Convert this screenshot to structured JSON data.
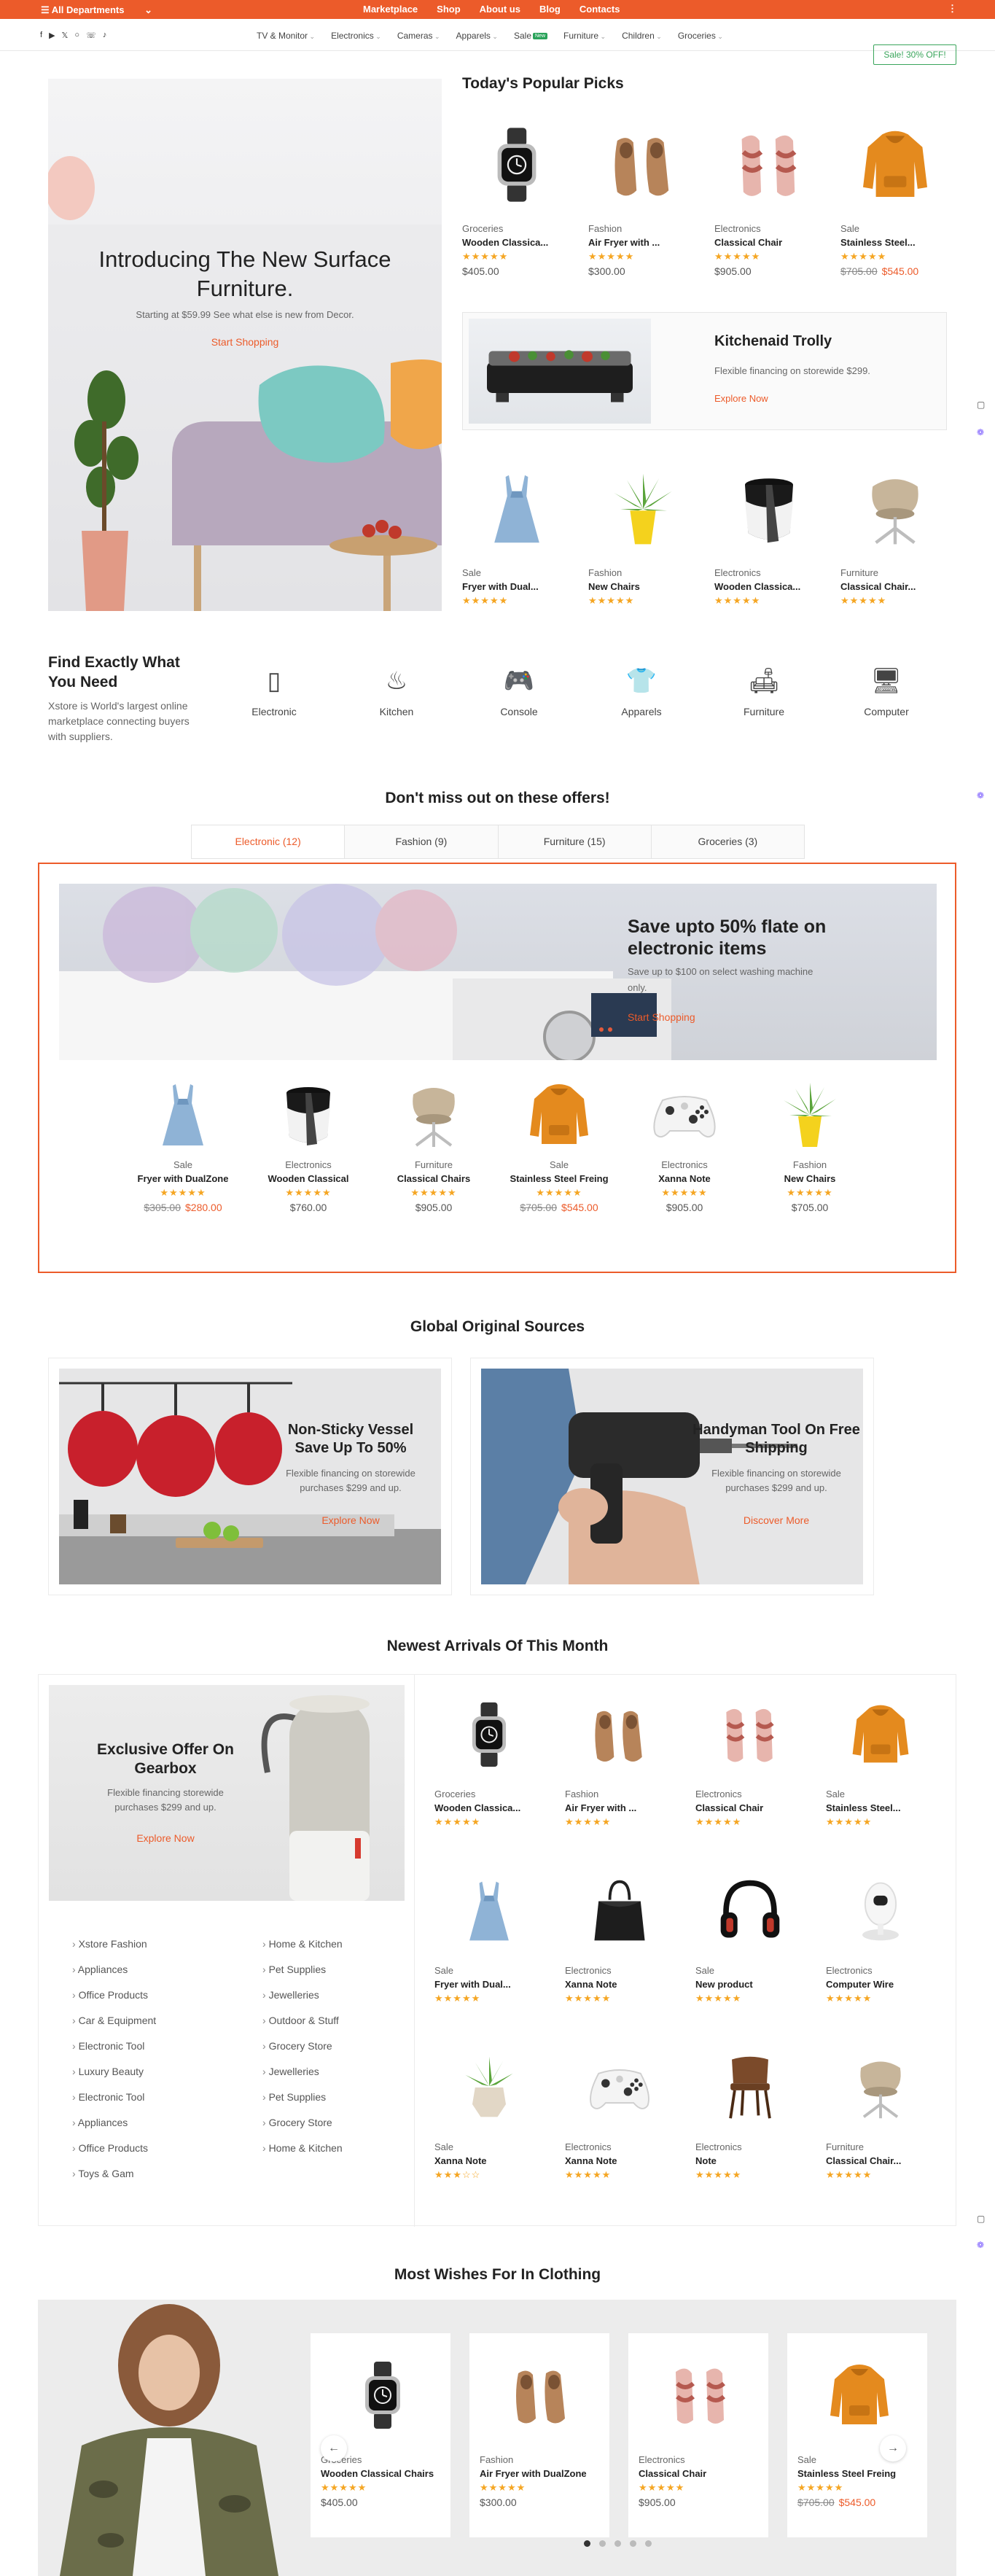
{
  "topbar": {
    "departments": "All Departments",
    "nav": [
      "Marketplace",
      "Shop",
      "About us",
      "Blog",
      "Contacts"
    ]
  },
  "secondary": {
    "categories": [
      "TV & Monitor",
      "Electronics",
      "Cameras",
      "Apparels",
      "Sale",
      "Furniture",
      "Children",
      "Groceries"
    ],
    "new_badge": "New",
    "sale_button": "Sale! 30% OFF!"
  },
  "hero": {
    "title": "Introducing The New Surface Furniture.",
    "subtitle": "Starting at $59.99 See what else is new from Decor.",
    "cta": "Start Shopping"
  },
  "popular": {
    "title": "Today's Popular Picks",
    "row1": [
      {
        "cat": "Groceries",
        "name": "Wooden Classica...",
        "stars": "★★★★★",
        "price": "$405.00",
        "old": "",
        "icon": "watch"
      },
      {
        "cat": "Fashion",
        "name": "Air Fryer with ...",
        "stars": "★★★★★",
        "price": "$300.00",
        "old": "",
        "icon": "shoes"
      },
      {
        "cat": "Electronics",
        "name": "Classical Chair",
        "stars": "★★★★★",
        "price": "$905.00",
        "old": "",
        "icon": "sandals"
      },
      {
        "cat": "Sale",
        "name": "Stainless Steel...",
        "stars": "★★★★★",
        "price": "$545.00",
        "old": "$705.00",
        "icon": "hoodie"
      }
    ],
    "banner": {
      "title": "Kitchenaid Trolly",
      "desc": "Flexible financing on storewide $299.",
      "cta": "Explore Now"
    },
    "row2": [
      {
        "cat": "Sale",
        "name": "Fryer with Dual...",
        "stars": "★★★★★",
        "icon": "dress"
      },
      {
        "cat": "Fashion",
        "name": "New Chairs",
        "stars": "★★★★★",
        "icon": "plant"
      },
      {
        "cat": "Electronics",
        "name": "Wooden Classica...",
        "stars": "★★★★★",
        "icon": "speaker"
      },
      {
        "cat": "Furniture",
        "name": "Classical Chair...",
        "stars": "★★★★★",
        "icon": "chair"
      }
    ]
  },
  "find": {
    "title": "Find Exactly What You Need",
    "desc": "Xstore is World's largest online marketplace connecting buyers with suppliers.",
    "items": [
      "Electronic",
      "Kitchen",
      "Console",
      "Apparels",
      "Furniture",
      "Computer"
    ]
  },
  "offers": {
    "title": "Don't miss out on these offers!",
    "tabs": [
      "Electronic (12)",
      "Fashion (9)",
      "Furniture (15)",
      "Groceries (3)"
    ],
    "banner": {
      "title": "Save upto 50% flate on electronic items",
      "desc": "Save up to $100 on select washing machine only.",
      "cta": "Start Shopping"
    },
    "products": [
      {
        "cat": "Sale",
        "name": "Fryer with DualZone",
        "stars": "★★★★★",
        "price": "$280.00",
        "old": "$305.00",
        "icon": "dress"
      },
      {
        "cat": "Electronics",
        "name": "Wooden Classical",
        "stars": "★★★★★",
        "price": "$760.00",
        "old": "",
        "icon": "speaker"
      },
      {
        "cat": "Furniture",
        "name": "Classical Chairs",
        "stars": "★★★★★",
        "price": "$905.00",
        "old": "",
        "icon": "chair"
      },
      {
        "cat": "Sale",
        "name": "Stainless Steel Freing",
        "stars": "★★★★★",
        "price": "$545.00",
        "old": "$705.00",
        "icon": "hoodie"
      },
      {
        "cat": "Electronics",
        "name": "Xanna Note",
        "stars": "★★★★★",
        "price": "$905.00",
        "old": "",
        "icon": "gamepad"
      },
      {
        "cat": "Fashion",
        "name": "New Chairs",
        "stars": "★★★★★",
        "price": "$705.00",
        "old": "",
        "icon": "plant"
      }
    ]
  },
  "sources": {
    "title": "Global Original Sources",
    "cards": [
      {
        "title": "Non-Sticky Vessel Save Up To 50%",
        "desc": "Flexible financing on storewide purchases $299 and up.",
        "cta": "Explore Now"
      },
      {
        "title": "Handyman Tool On Free Shipping",
        "desc": "Flexible financing on storewide purchases $299 and up.",
        "cta": "Discover More"
      }
    ]
  },
  "newest": {
    "title": "Newest Arrivals Of This Month",
    "promo": {
      "title": "Exclusive Offer On Gearbox",
      "desc": "Flexible financing storewide purchases $299 and up.",
      "cta": "Explore Now"
    },
    "links_left": [
      "Xstore Fashion",
      "Appliances",
      "Office Products",
      "Car & Equipment",
      "Electronic Tool",
      "Luxury Beauty",
      "Electronic Tool",
      "Appliances",
      "Office Products",
      "Toys & Gam"
    ],
    "links_right": [
      "Home & Kitchen",
      "Pet Supplies",
      "Jewelleries",
      "Outdoor & Stuff",
      "Grocery Store",
      "Jewelleries",
      "Pet Supplies",
      "Grocery Store",
      "Home & Kitchen"
    ],
    "products": [
      {
        "cat": "Groceries",
        "name": "Wooden Classica...",
        "stars": "★★★★★",
        "icon": "watch"
      },
      {
        "cat": "Fashion",
        "name": "Air Fryer with ...",
        "stars": "★★★★★",
        "icon": "shoes"
      },
      {
        "cat": "Electronics",
        "name": "Classical Chair",
        "stars": "★★★★★",
        "icon": "sandals"
      },
      {
        "cat": "Sale",
        "name": "Stainless Steel...",
        "stars": "★★★★★",
        "icon": "hoodie"
      },
      {
        "cat": "Sale",
        "name": "Fryer with Dual...",
        "stars": "★★★★★",
        "icon": "dress"
      },
      {
        "cat": "Electronics",
        "name": "Xanna Note",
        "stars": "★★★★★",
        "icon": "bag"
      },
      {
        "cat": "Sale",
        "name": "New product",
        "stars": "★★★★★",
        "icon": "headphones"
      },
      {
        "cat": "Electronics",
        "name": "Computer Wire",
        "stars": "★★★★★",
        "icon": "robot"
      },
      {
        "cat": "Sale",
        "name": "Xanna Note",
        "stars": "★★★☆☆",
        "icon": "plant2"
      },
      {
        "cat": "Electronics",
        "name": "Xanna Note",
        "stars": "★★★★★",
        "icon": "gamepad"
      },
      {
        "cat": "Electronics",
        "name": "Note",
        "stars": "★★★★★",
        "icon": "woodchair"
      },
      {
        "cat": "Furniture",
        "name": "Classical Chair...",
        "stars": "★★★★★",
        "icon": "chair"
      }
    ]
  },
  "wishes": {
    "title": "Most Wishes For In Clothing",
    "products": [
      {
        "cat": "Groceries",
        "name": "Wooden Classical Chairs",
        "stars": "★★★★★",
        "price": "$405.00",
        "old": "",
        "icon": "watch"
      },
      {
        "cat": "Fashion",
        "name": "Air Fryer with DualZone",
        "stars": "★★★★★",
        "price": "$300.00",
        "old": "",
        "icon": "shoes"
      },
      {
        "cat": "Electronics",
        "name": "Classical Chair",
        "stars": "★★★★★",
        "price": "$905.00",
        "old": "",
        "icon": "sandals"
      },
      {
        "cat": "Sale",
        "name": "Stainless Steel Freing",
        "stars": "★★★★★",
        "price": "$545.00",
        "old": "$705.00",
        "icon": "hoodie"
      }
    ]
  },
  "colors": {
    "accent": "#ec5b2a",
    "sale_green": "#3aa55b",
    "star": "#f5a623"
  }
}
